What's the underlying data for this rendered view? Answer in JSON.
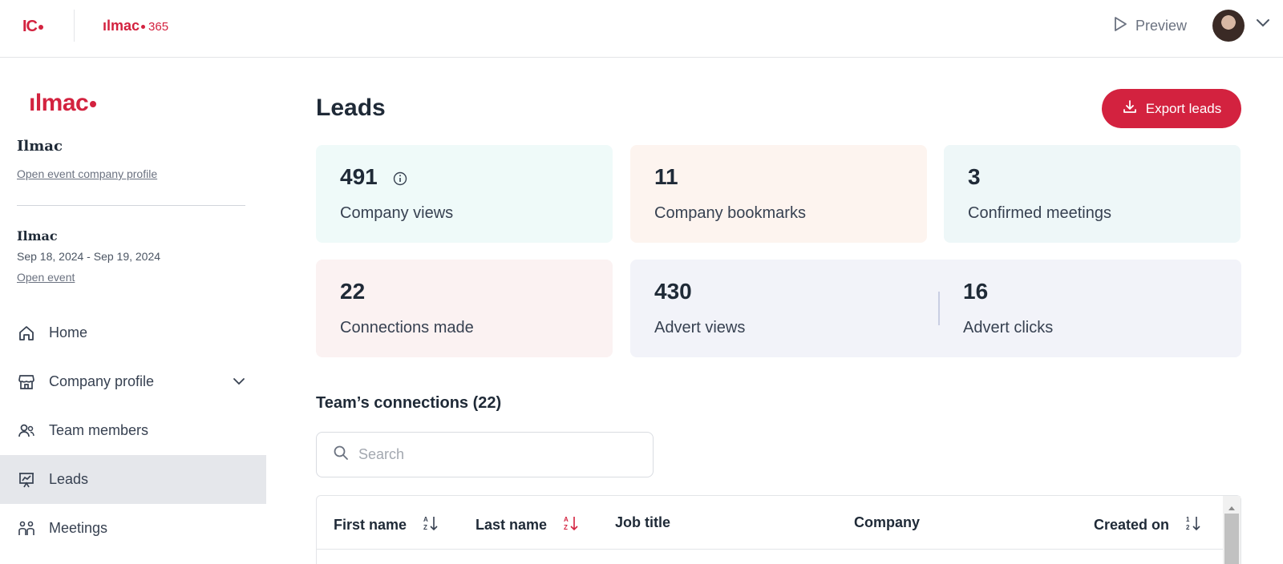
{
  "topbar": {
    "brand_short": "IC",
    "brand_name": "ılmac",
    "brand_suffix": "365",
    "preview_label": "Preview"
  },
  "sidebar": {
    "logo": "ılmac",
    "company_name": "Ilmac",
    "company_link": "Open event company profile",
    "event_name": "Ilmac",
    "event_dates": "Sep 18, 2024 - Sep 19, 2024",
    "event_link": "Open event",
    "nav": [
      {
        "label": "Home",
        "icon": "home-icon"
      },
      {
        "label": "Company profile",
        "icon": "store-icon"
      },
      {
        "label": "Team members",
        "icon": "team-icon"
      },
      {
        "label": "Leads",
        "icon": "presentation-chart-icon",
        "active": true
      },
      {
        "label": "Meetings",
        "icon": "meetings-icon"
      }
    ]
  },
  "main": {
    "title": "Leads",
    "export_label": "Export leads",
    "stats": {
      "views": {
        "value": "491",
        "label": "Company views"
      },
      "bookmarks": {
        "value": "11",
        "label": "Company bookmarks"
      },
      "meetings": {
        "value": "3",
        "label": "Confirmed meetings"
      },
      "connections": {
        "value": "22",
        "label": "Connections made"
      },
      "advert_views": {
        "value": "430",
        "label": "Advert views"
      },
      "advert_clicks": {
        "value": "16",
        "label": "Advert clicks"
      }
    },
    "section_title": "Team’s connections (22)",
    "search": {
      "placeholder": "Search",
      "value": ""
    },
    "table": {
      "columns": [
        "First name",
        "Last name",
        "Job title",
        "Company",
        "Created on"
      ]
    }
  },
  "colors": {
    "accent": "#d3223f",
    "text": "#1f2a37",
    "muted": "#6b7280"
  }
}
